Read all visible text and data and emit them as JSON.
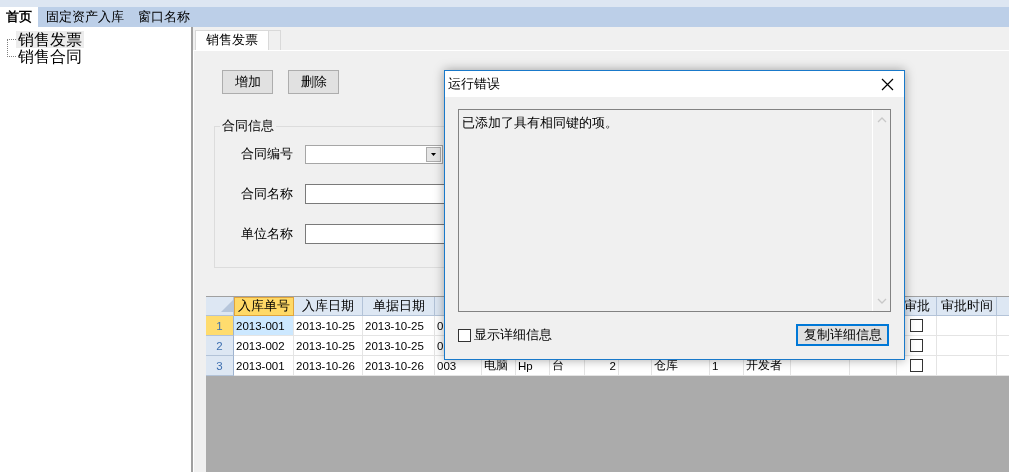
{
  "menu_tabs": [
    {
      "label": "首页",
      "selected": true
    },
    {
      "label": "固定资产入库",
      "selected": false
    },
    {
      "label": "窗口名称",
      "selected": false
    }
  ],
  "tree": {
    "items": [
      {
        "label": "销售发票",
        "selected": true
      },
      {
        "label": "销售合同",
        "selected": false
      }
    ]
  },
  "document_tabs": [
    {
      "label": "销售发票",
      "selected": true
    }
  ],
  "toolbar": {
    "buttons": [
      "增加",
      "删除"
    ]
  },
  "group": {
    "title": "合同信息",
    "fields": [
      {
        "kind": "combo",
        "label": "合同编号"
      },
      {
        "kind": "text",
        "label": "合同名称"
      },
      {
        "kind": "text",
        "label": "单位名称"
      }
    ]
  },
  "grid": {
    "columns": [
      {
        "label": "入库单号",
        "selected": true,
        "kind": "text"
      },
      {
        "label": "入库日期",
        "selected": false,
        "kind": "text"
      },
      {
        "label": "单据日期",
        "selected": false,
        "kind": "text"
      },
      {
        "kind": "text"
      },
      {
        "kind": "text"
      },
      {
        "kind": "text"
      },
      {
        "kind": "text"
      },
      {
        "kind": "text"
      },
      {
        "kind": "text"
      },
      {
        "kind": "text"
      },
      {
        "kind": "text"
      },
      {
        "kind": "text"
      },
      {
        "kind": "text"
      },
      {
        "kind": "text"
      },
      {
        "label": "审批",
        "selected": false,
        "kind": "check"
      },
      {
        "label": "审批时间",
        "selected": false,
        "kind": "text"
      },
      {
        "kind": "text"
      }
    ],
    "rows": [
      {
        "number": "1",
        "selected": true,
        "approved": false,
        "cells": [
          "2013-001",
          "2013-10-25",
          "2013-10-25",
          "0",
          null,
          null,
          null,
          null,
          null,
          null,
          null,
          null,
          null,
          null,
          null,
          null
        ]
      },
      {
        "number": "2",
        "selected": false,
        "approved": false,
        "cells": [
          "2013-002",
          "2013-10-25",
          "2013-10-25",
          "0",
          null,
          null,
          null,
          null,
          null,
          null,
          null,
          null,
          null,
          null,
          null,
          null
        ]
      },
      {
        "number": "3",
        "selected": false,
        "approved": false,
        "cells": [
          "2013-001",
          "2013-10-26",
          "2013-10-26",
          "003",
          "电脑",
          "Hp",
          "台",
          "2",
          null,
          "仓库",
          "1",
          "开发者",
          null,
          null,
          null,
          null
        ]
      }
    ]
  },
  "dialog": {
    "title": "运行错误",
    "message": "已添加了具有相同键的项。",
    "checkbox": {
      "label": "显示详细信息",
      "checked": false
    },
    "button": "复制详细信息"
  }
}
